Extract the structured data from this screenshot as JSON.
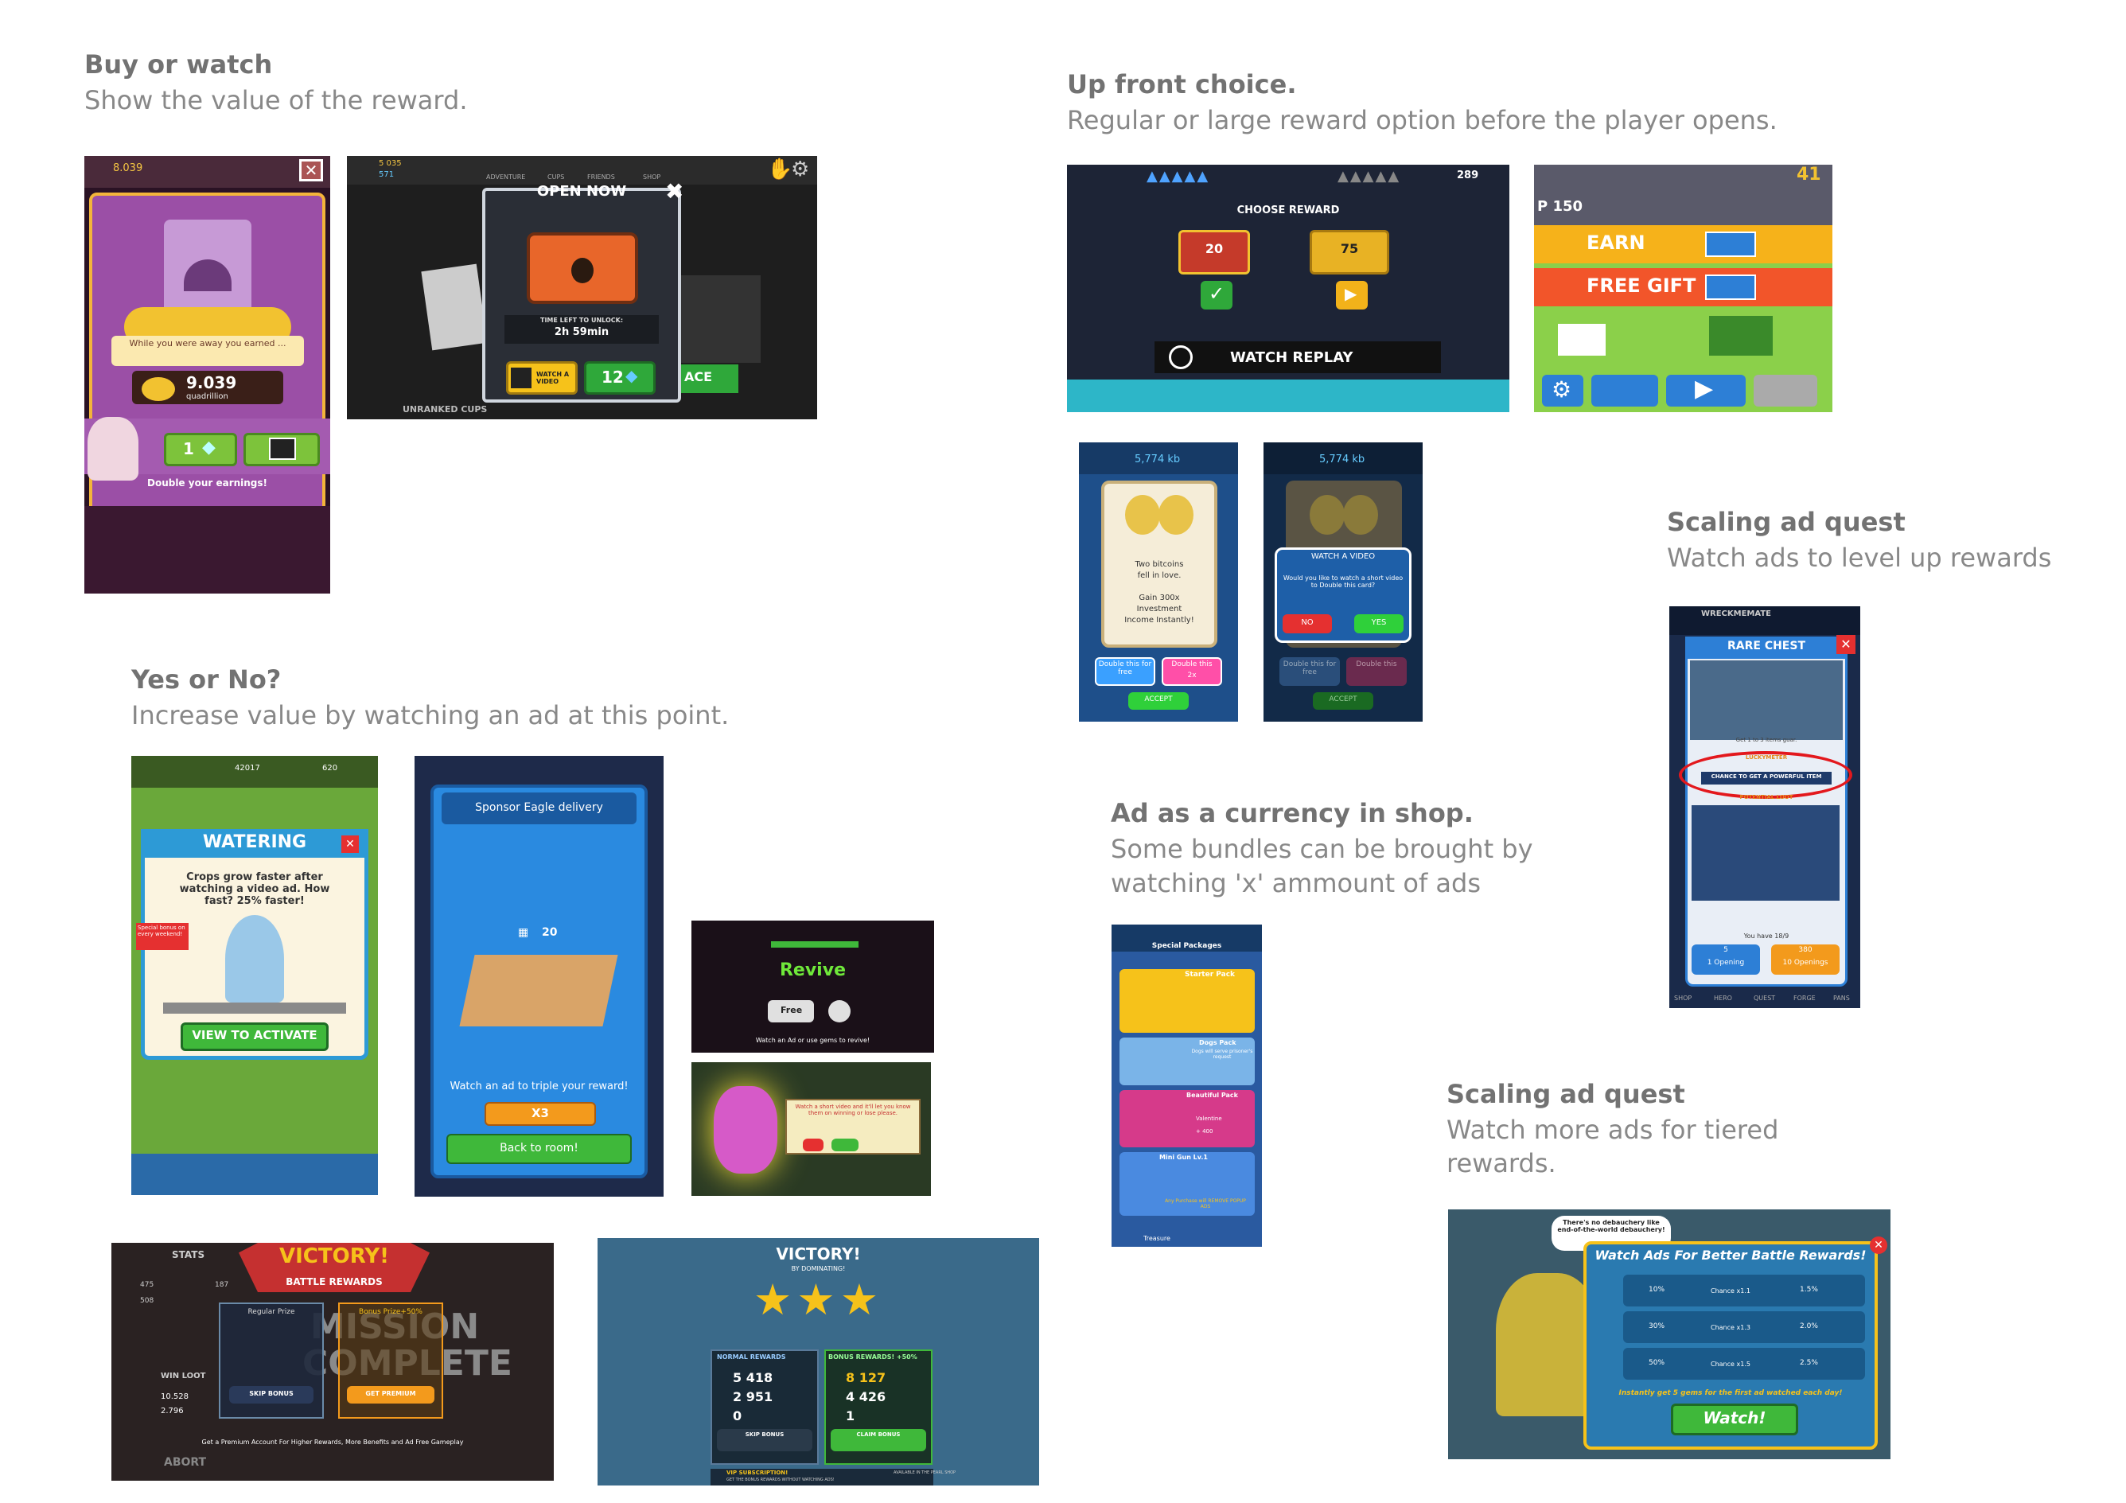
{
  "sections": {
    "buy_or_watch": {
      "title": "Buy or watch",
      "desc": "Show the value of the reward."
    },
    "up_front": {
      "title": "Up front choice.",
      "desc": "Regular or large reward option before the player opens."
    },
    "yes_no": {
      "title": "Yes or No?",
      "desc": "Increase value by watching an ad at this point."
    },
    "scaling1": {
      "title": "Scaling ad quest",
      "desc": "Watch ads to level up rewards"
    },
    "currency": {
      "title": "Ad as a currency in shop.",
      "desc1": "Some bundles can be brought by",
      "desc2": "watching 'x' ammount of ads"
    },
    "scaling2": {
      "title": "Scaling ad quest",
      "desc1": "Watch more ads for tiered",
      "desc2": "rewards."
    }
  },
  "shot_castle": {
    "top_value": "8.039",
    "banner": "While you were away you earned ...",
    "amount": "9.039",
    "unit": "quadrillion",
    "gem_count": "1",
    "footer": "Double your earnings!"
  },
  "shot_chest": {
    "title": "OPEN NOW",
    "coins": "5 035",
    "gems": "571",
    "tabs": [
      "ADVENTURE",
      "CUPS",
      "FRIENDS",
      "SHOP"
    ],
    "timer_label": "TIME LEFT TO UNLOCK:",
    "timer": "2h 59min",
    "watch": "WATCH A VIDEO",
    "gems_cost": "12",
    "footer": "UNRANKED CUPS",
    "race": "ACE"
  },
  "shot_choose": {
    "title": "CHOOSE REWARD",
    "left": "20",
    "right": "75",
    "score": "289",
    "replay": "WATCH REPLAY"
  },
  "shot_crossy": {
    "score": "P 150",
    "top": "41",
    "earn": "EARN",
    "gift": "FREE GIFT"
  },
  "shot_bit1": {
    "value": "5,774 kb",
    "l1": "Two bitcoins",
    "l2": "fell in love.",
    "l3": "Gain 300x",
    "l4": "Investment",
    "l5": "Income Instantly!",
    "b1": "Double this for free",
    "b2": "Double this",
    "b2b": "2x",
    "accept": "ACCEPT"
  },
  "shot_bit2": {
    "value": "5,774 kb",
    "t": "WATCH A VIDEO",
    "q": "Would you like to watch a short video to Double this card?",
    "no": "NO",
    "yes": "YES",
    "b1": "Double this for free",
    "b2": "Double this",
    "accept": "ACCEPT"
  },
  "shot_rare": {
    "top": "WRECKMEMATE",
    "title": "RARE CHEST",
    "get": "Get 1 to 3 items guar.",
    "luck": "LUCKYMETER",
    "chance": "CHANCE TO GET A POWERFUL ITEM",
    "loot": "POTENTIAL LOOT",
    "have": "You have 18/9",
    "b1": "1 Opening",
    "b1v": "5",
    "b2": "10 Openings",
    "b2v": "380",
    "tabs": [
      "SHOP",
      "HERO",
      "QUEST",
      "FORGE",
      "PANS"
    ]
  },
  "shot_water": {
    "title": "WATERING",
    "text": "Crops grow faster after watching a video ad. How fast? 25% faster!",
    "tag": "Special bonus on every weekend!",
    "btn": "VIEW TO ACTIVATE",
    "coins": "42017",
    "gems": "620"
  },
  "shot_eagle": {
    "title": "Sponsor Eagle delivery",
    "count": "20",
    "msg": "Watch an ad to triple your reward!",
    "x3": "X3",
    "back": "Back to room!"
  },
  "shot_revive": {
    "title": "Revive",
    "free": "Free",
    "footer": "Watch an Ad or use gems to revive!"
  },
  "shot_monster": {
    "text": "Watch a short video and it'll let you know them on winning or lose please."
  },
  "shot_victory1": {
    "title": "VICTORY!",
    "sub": "BATTLE REWARDS",
    "stats": "STATS",
    "regular": "Regular Prize",
    "bonus": "Bonus Prize+50%",
    "skip": "SKIP BONUS",
    "premium": "GET PREMIUM",
    "win": "WIN LOOT",
    "w1": "10.528",
    "w2": "2.796",
    "mission": "MISSION",
    "complete": "COMPLETE",
    "footer": "Get a Premium Account For Higher Rewards, More Benefits and Ad Free Gameplay",
    "abort": "ABORT",
    "s1": "475",
    "s2": "508",
    "s3": "187"
  },
  "shot_victory2": {
    "title": "VICTORY!",
    "sub": "BY DOMINATING!",
    "normal": "NORMAL REWARDS",
    "bonus": "BONUS REWARDS! +50%",
    "n1": "5 418",
    "n2": "2 951",
    "n3": "0",
    "b1": "8 127",
    "b2": "4 426",
    "b3": "1",
    "skip": "SKIP BONUS",
    "claim": "CLAIM BONUS",
    "vip": "VIP SUBSCRIPTION!",
    "vip2": "GET THE BONUS REWARDS WITHOUT WATCHING ADS!",
    "avail": "AVAILABLE IN THE PEARL SHOP"
  },
  "shot_shop": {
    "title": "Special Packages",
    "p1": "Starter Pack",
    "p2": "Dogs Pack",
    "p2d": "Dogs will serve prisoner's request",
    "p3": "Beautiful Pack",
    "p3d": "Valentine",
    "p3v": "+ 400",
    "p4": "Mini Gun Lv.1",
    "p4d": "Any Purchase will REMOVE POPUP ADS",
    "footer": "Treasure"
  },
  "shot_battle": {
    "bubble": "There's no debauchery like end-of-the-world debauchery!",
    "title": "Watch Ads For Better Battle Rewards!",
    "r1": [
      "10%",
      "Chance x1.1",
      "1.5%"
    ],
    "r2": [
      "30%",
      "Chance x1.3",
      "2.0%"
    ],
    "r3": [
      "50%",
      "Chance x1.5",
      "2.5%"
    ],
    "note": "Instantly get 5 gems for the first ad watched each day!",
    "watch": "Watch!"
  },
  "colors": {
    "accent_green": "#2fa83a",
    "accent_orange": "#f39a1c",
    "accent_blue": "#2d7fd6",
    "text_heading": "#727272",
    "text_desc": "#888888"
  }
}
